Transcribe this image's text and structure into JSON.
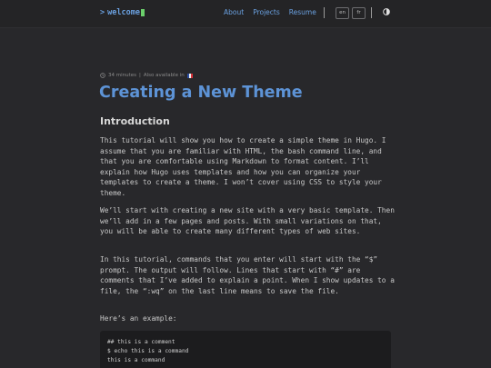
{
  "header": {
    "logo_prompt": ">",
    "logo_text": "welcome",
    "nav": [
      "About",
      "Projects",
      "Resume"
    ],
    "languages": [
      "en",
      "fr"
    ],
    "theme_toggle_icon": "half-circle-icon"
  },
  "meta": {
    "reading_time": "34 minutes",
    "separator": "|",
    "also_available": "Also available in"
  },
  "article": {
    "title": "Creating a New Theme",
    "section_heading": "Introduction",
    "paragraphs": [
      "This tutorial will show you how to create a simple theme in Hugo. I assume that you are familiar with HTML, the bash command line, and that you are comfortable using Markdown to format content. I’ll explain how Hugo uses templates and how you can organize your templates to create a theme. I won’t cover using CSS to style your theme.",
      "We’ll start with creating a new site with a very basic template. Then we’ll add in a few pages and posts. With small variations on that, you will be able to create many different types of web sites.",
      "In this tutorial, commands that you enter will start with the “$” prompt. The output will follow. Lines that start with “#” are comments that I’ve added to explain a point. When I show updates to a file, the “:wq” on the last line means to save the file.",
      "Here’s an example:"
    ],
    "code_lines": [
      "## this is a comment",
      "$ echo this is a command",
      "this is a command"
    ]
  },
  "colors": {
    "accent": "#5d93d6",
    "background": "#28282b",
    "header_bg": "#242426"
  }
}
